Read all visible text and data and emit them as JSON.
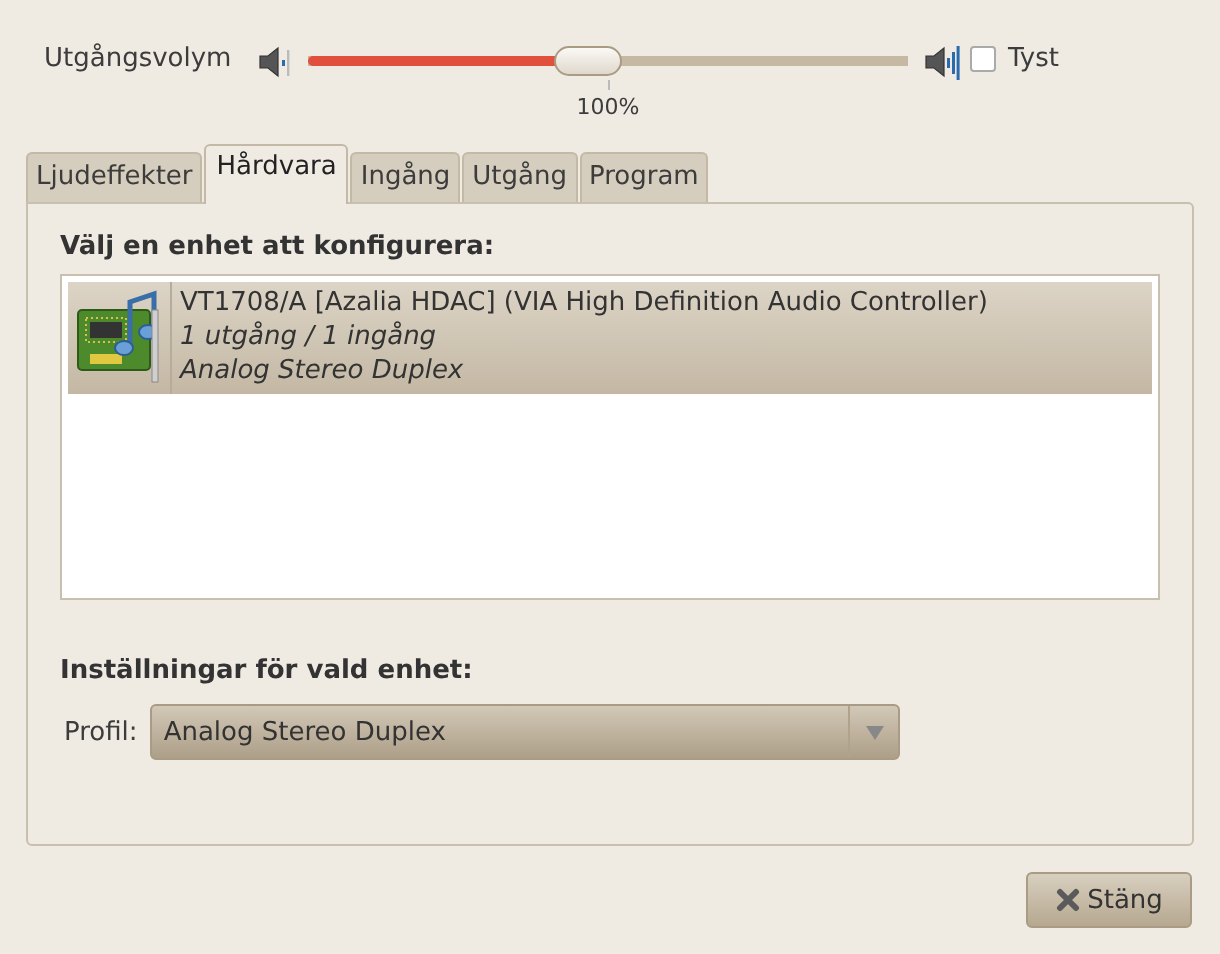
{
  "volume": {
    "label": "Utgångsvolym",
    "level": 0.47,
    "reading": "100%",
    "mute": {
      "label": "Tyst",
      "checked": false
    }
  },
  "tabs": [
    {
      "label": "Ljudeffekter",
      "selected": false
    },
    {
      "label": "Hårdvara",
      "selected": true
    },
    {
      "label": "Ingång",
      "selected": false
    },
    {
      "label": "Utgång",
      "selected": false
    },
    {
      "label": "Program",
      "selected": false
    }
  ],
  "devices": {
    "heading": "Välj en enhet att konfigurera:",
    "items": [
      {
        "name": "VT1708/A [Azalia HDAC] (VIA High Definition Audio Controller)",
        "ports": "1 utgång / 1 ingång",
        "profile": "Analog Stereo Duplex",
        "selected": true
      }
    ]
  },
  "settings": {
    "heading": "Inställningar för vald enhet:",
    "profile_label": "Profil:",
    "profile_value": "Analog Stereo Duplex"
  },
  "buttons": [
    {
      "label": "Stäng",
      "kind": "close"
    }
  ]
}
